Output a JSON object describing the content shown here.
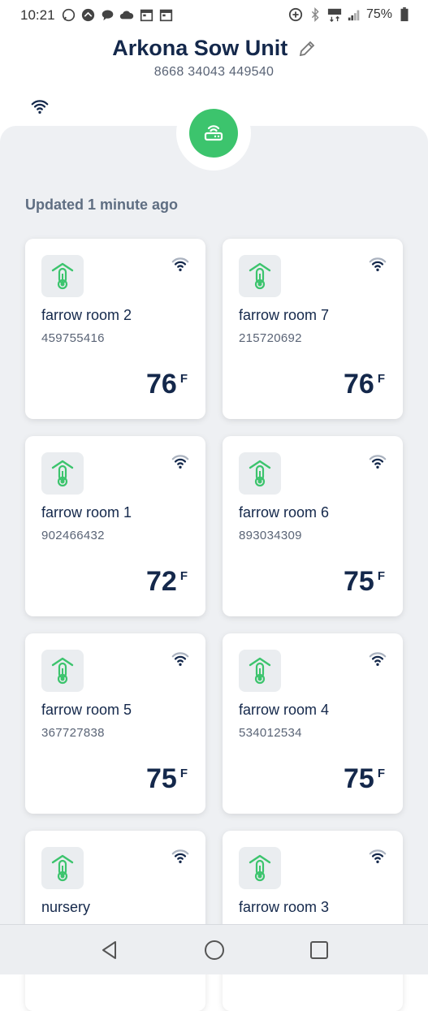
{
  "status_bar": {
    "time": "10:21",
    "battery": "75%",
    "left_icons": [
      "whatsapp-icon",
      "app-icon",
      "message-icon",
      "cloud-icon",
      "calendar-icon",
      "calendar-icon"
    ],
    "right_icons": [
      "data-saver-icon",
      "bluetooth-icon",
      "lte-icon",
      "signal-icon",
      "battery-icon"
    ]
  },
  "header": {
    "title": "Arkona Sow Unit",
    "device_id": "8668 34043 449540"
  },
  "hub": {
    "status_color": "#3cc46d",
    "icon": "router-icon"
  },
  "updated_text": "Updated 1 minute ago",
  "cards": [
    {
      "name": "farrow room 2",
      "id": "459755416",
      "temp": "76",
      "unit": "F"
    },
    {
      "name": "farrow room 7",
      "id": "215720692",
      "temp": "76",
      "unit": "F"
    },
    {
      "name": "farrow room 1",
      "id": "902466432",
      "temp": "72",
      "unit": "F"
    },
    {
      "name": "farrow room 6",
      "id": "893034309",
      "temp": "75",
      "unit": "F"
    },
    {
      "name": "farrow room 5",
      "id": "367727838",
      "temp": "75",
      "unit": "F"
    },
    {
      "name": "farrow room 4",
      "id": "534012534",
      "temp": "75",
      "unit": "F"
    },
    {
      "name": "nursery",
      "id": "",
      "temp": "",
      "unit": ""
    },
    {
      "name": "farrow room 3",
      "id": "",
      "temp": "",
      "unit": ""
    }
  ],
  "colors": {
    "accent_green": "#3cc46d",
    "text_dark": "#14284b",
    "panel_bg": "#eef0f3"
  },
  "nav": {
    "icons": [
      "back-icon",
      "home-icon",
      "recents-icon"
    ]
  }
}
